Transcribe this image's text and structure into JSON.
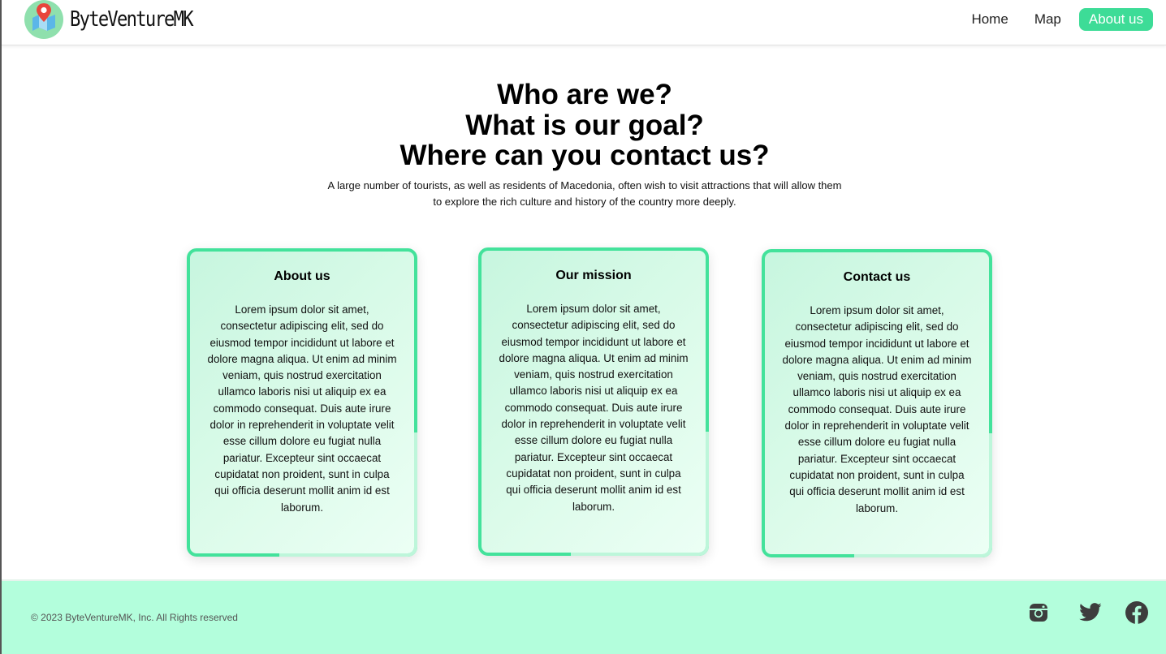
{
  "brand": {
    "name": "ByteVentureMK",
    "logo_icon": "map-pin-logo-icon"
  },
  "nav": {
    "items": [
      {
        "label": "Home",
        "active": false
      },
      {
        "label": "Map",
        "active": false
      },
      {
        "label": "About us",
        "active": true
      }
    ]
  },
  "hero": {
    "title_lines": [
      "Who are we?",
      "What is our goal?",
      "Where can you contact us?"
    ],
    "description": "A large number of tourists, as well as residents of Macedonia, often wish to visit attractions that will allow them to explore the rich culture and history of the country more deeply."
  },
  "cards": [
    {
      "title": "About us",
      "body": "Lorem ipsum dolor sit amet, consectetur adipiscing elit, sed do eiusmod tempor incididunt ut labore et dolore magna aliqua. Ut enim ad minim veniam, quis nostrud exercitation ullamco laboris nisi ut aliquip ex ea commodo consequat. Duis aute irure dolor in reprehenderit in voluptate velit esse cillum dolore eu fugiat nulla pariatur. Excepteur sint occaecat cupidatat non proident, sunt in culpa qui officia deserunt mollit anim id est laborum."
    },
    {
      "title": "Our mission",
      "body": "Lorem ipsum dolor sit amet, consectetur adipiscing elit, sed do eiusmod tempor incididunt ut labore et dolore magna aliqua. Ut enim ad minim veniam, quis nostrud exercitation ullamco laboris nisi ut aliquip ex ea commodo consequat. Duis aute irure dolor in reprehenderit in voluptate velit esse cillum dolore eu fugiat nulla pariatur. Excepteur sint occaecat cupidatat non proident, sunt in culpa qui officia deserunt mollit anim id est laborum."
    },
    {
      "title": "Contact us",
      "body": "Lorem ipsum dolor sit amet, consectetur adipiscing elit, sed do eiusmod tempor incididunt ut labore et dolore magna aliqua. Ut enim ad minim veniam, quis nostrud exercitation ullamco laboris nisi ut aliquip ex ea commodo consequat. Duis aute irure dolor in reprehenderit in voluptate velit esse cillum dolore eu fugiat nulla pariatur. Excepteur sint occaecat cupidatat non proident, sunt in culpa qui officia deserunt mollit anim id est laborum."
    }
  ],
  "footer": {
    "copyright": "© 2023 ByteVentureMK, Inc. All Rights reserved",
    "social": [
      "instagram-icon",
      "twitter-icon",
      "facebook-icon"
    ]
  },
  "colors": {
    "accent": "#3ddc97",
    "card_border": "#43e29b",
    "footer_bg": "#b3fedc",
    "logo_bg": "#8fe0ad"
  }
}
